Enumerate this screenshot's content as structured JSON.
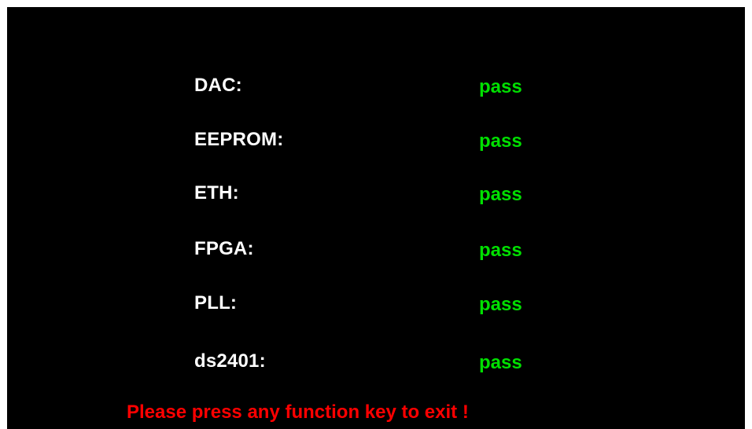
{
  "tests": [
    {
      "label": "DAC:",
      "status": "pass"
    },
    {
      "label": "EEPROM:",
      "status": "pass"
    },
    {
      "label": "ETH:",
      "status": "pass"
    },
    {
      "label": "FPGA:",
      "status": "pass"
    },
    {
      "label": "PLL:",
      "status": "pass"
    },
    {
      "label": "ds2401:",
      "status": "pass"
    }
  ],
  "footer": {
    "message": "Please press any function key to exit !"
  },
  "colors": {
    "background": "#000000",
    "label": "#ffffff",
    "pass": "#00e000",
    "message": "#ff0000"
  }
}
